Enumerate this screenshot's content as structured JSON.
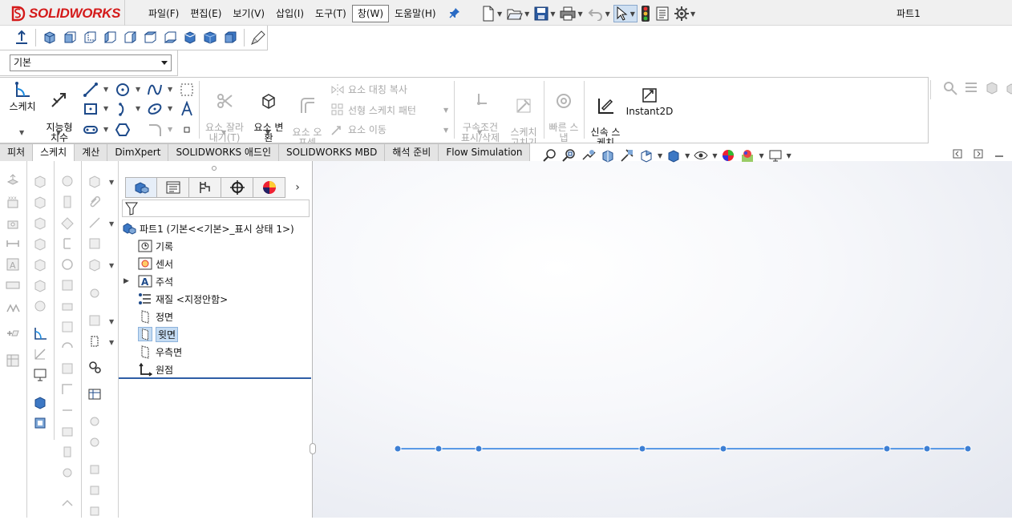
{
  "app": {
    "logo_text": "SOLIDWORKS",
    "doc_title": "파트1"
  },
  "menu": [
    {
      "id": "file",
      "label": "파일(F)"
    },
    {
      "id": "edit",
      "label": "편집(E)"
    },
    {
      "id": "view",
      "label": "보기(V)"
    },
    {
      "id": "insert",
      "label": "삽입(I)"
    },
    {
      "id": "tools",
      "label": "도구(T)"
    },
    {
      "id": "window",
      "label": "창(W)",
      "active": true
    },
    {
      "id": "help",
      "label": "도움말(H)"
    }
  ],
  "config": {
    "selected": "기본"
  },
  "command_manager": {
    "sketch": "스케치",
    "smart_dim": "지능형\n치수",
    "trim": "요소 잘라\n내기(T)",
    "convert": "요소 변\n환",
    "offset": "요소 오\n프셋",
    "mirror": "요소 대칭 복사",
    "pattern": "선형 스케치 패턴",
    "move": "요소 이동",
    "relations": "구속조건\n표시/삭제",
    "repair": "스케치\n고치기",
    "quick_snaps": "빠른 스\n냅",
    "rapid_sketch": "신속 스\n케치",
    "instant2d": "Instant2D"
  },
  "tabs": [
    {
      "label": "피처"
    },
    {
      "label": "스케치",
      "active": true
    },
    {
      "label": "계산"
    },
    {
      "label": "DimXpert"
    },
    {
      "label": "SOLIDWORKS 애드인"
    },
    {
      "label": "SOLIDWORKS MBD"
    },
    {
      "label": "해석 준비"
    },
    {
      "label": "Flow Simulation"
    }
  ],
  "tree": {
    "root": "파트1  (기본<<기본>_표시 상태 1>)",
    "items": [
      {
        "label": "기록",
        "icon": "history-icon"
      },
      {
        "label": "센서",
        "icon": "sensor-icon"
      },
      {
        "label": "주석",
        "icon": "annotation-icon",
        "expandable": true
      },
      {
        "label": "재질 <지정안함>",
        "icon": "material-icon"
      },
      {
        "label": "정면",
        "icon": "plane-icon"
      },
      {
        "label": "윗면",
        "icon": "plane-icon",
        "selected": true
      },
      {
        "label": "우측면",
        "icon": "plane-icon"
      },
      {
        "label": "원점",
        "icon": "origin-icon"
      }
    ]
  },
  "colors": {
    "accent": "#2e5ea6",
    "sketch_line": "#4a8fe0",
    "selection": "#c5dcf3",
    "logo": "#d41a1a"
  }
}
